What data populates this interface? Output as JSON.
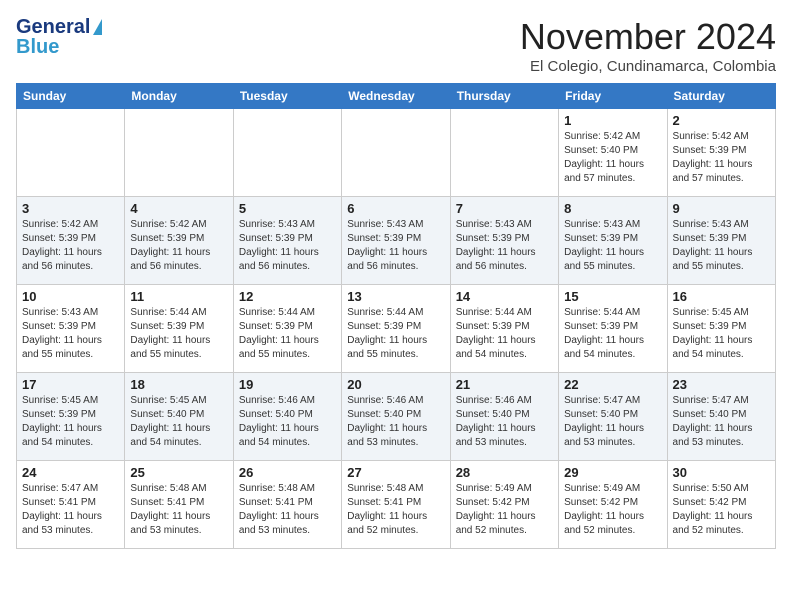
{
  "header": {
    "logo_line1": "General",
    "logo_line2": "Blue",
    "month_title": "November 2024",
    "location": "El Colegio, Cundinamarca, Colombia"
  },
  "weekdays": [
    "Sunday",
    "Monday",
    "Tuesday",
    "Wednesday",
    "Thursday",
    "Friday",
    "Saturday"
  ],
  "weeks": [
    [
      {
        "day": "",
        "info": ""
      },
      {
        "day": "",
        "info": ""
      },
      {
        "day": "",
        "info": ""
      },
      {
        "day": "",
        "info": ""
      },
      {
        "day": "",
        "info": ""
      },
      {
        "day": "1",
        "info": "Sunrise: 5:42 AM\nSunset: 5:40 PM\nDaylight: 11 hours\nand 57 minutes."
      },
      {
        "day": "2",
        "info": "Sunrise: 5:42 AM\nSunset: 5:39 PM\nDaylight: 11 hours\nand 57 minutes."
      }
    ],
    [
      {
        "day": "3",
        "info": "Sunrise: 5:42 AM\nSunset: 5:39 PM\nDaylight: 11 hours\nand 56 minutes."
      },
      {
        "day": "4",
        "info": "Sunrise: 5:42 AM\nSunset: 5:39 PM\nDaylight: 11 hours\nand 56 minutes."
      },
      {
        "day": "5",
        "info": "Sunrise: 5:43 AM\nSunset: 5:39 PM\nDaylight: 11 hours\nand 56 minutes."
      },
      {
        "day": "6",
        "info": "Sunrise: 5:43 AM\nSunset: 5:39 PM\nDaylight: 11 hours\nand 56 minutes."
      },
      {
        "day": "7",
        "info": "Sunrise: 5:43 AM\nSunset: 5:39 PM\nDaylight: 11 hours\nand 56 minutes."
      },
      {
        "day": "8",
        "info": "Sunrise: 5:43 AM\nSunset: 5:39 PM\nDaylight: 11 hours\nand 55 minutes."
      },
      {
        "day": "9",
        "info": "Sunrise: 5:43 AM\nSunset: 5:39 PM\nDaylight: 11 hours\nand 55 minutes."
      }
    ],
    [
      {
        "day": "10",
        "info": "Sunrise: 5:43 AM\nSunset: 5:39 PM\nDaylight: 11 hours\nand 55 minutes."
      },
      {
        "day": "11",
        "info": "Sunrise: 5:44 AM\nSunset: 5:39 PM\nDaylight: 11 hours\nand 55 minutes."
      },
      {
        "day": "12",
        "info": "Sunrise: 5:44 AM\nSunset: 5:39 PM\nDaylight: 11 hours\nand 55 minutes."
      },
      {
        "day": "13",
        "info": "Sunrise: 5:44 AM\nSunset: 5:39 PM\nDaylight: 11 hours\nand 55 minutes."
      },
      {
        "day": "14",
        "info": "Sunrise: 5:44 AM\nSunset: 5:39 PM\nDaylight: 11 hours\nand 54 minutes."
      },
      {
        "day": "15",
        "info": "Sunrise: 5:44 AM\nSunset: 5:39 PM\nDaylight: 11 hours\nand 54 minutes."
      },
      {
        "day": "16",
        "info": "Sunrise: 5:45 AM\nSunset: 5:39 PM\nDaylight: 11 hours\nand 54 minutes."
      }
    ],
    [
      {
        "day": "17",
        "info": "Sunrise: 5:45 AM\nSunset: 5:39 PM\nDaylight: 11 hours\nand 54 minutes."
      },
      {
        "day": "18",
        "info": "Sunrise: 5:45 AM\nSunset: 5:40 PM\nDaylight: 11 hours\nand 54 minutes."
      },
      {
        "day": "19",
        "info": "Sunrise: 5:46 AM\nSunset: 5:40 PM\nDaylight: 11 hours\nand 54 minutes."
      },
      {
        "day": "20",
        "info": "Sunrise: 5:46 AM\nSunset: 5:40 PM\nDaylight: 11 hours\nand 53 minutes."
      },
      {
        "day": "21",
        "info": "Sunrise: 5:46 AM\nSunset: 5:40 PM\nDaylight: 11 hours\nand 53 minutes."
      },
      {
        "day": "22",
        "info": "Sunrise: 5:47 AM\nSunset: 5:40 PM\nDaylight: 11 hours\nand 53 minutes."
      },
      {
        "day": "23",
        "info": "Sunrise: 5:47 AM\nSunset: 5:40 PM\nDaylight: 11 hours\nand 53 minutes."
      }
    ],
    [
      {
        "day": "24",
        "info": "Sunrise: 5:47 AM\nSunset: 5:41 PM\nDaylight: 11 hours\nand 53 minutes."
      },
      {
        "day": "25",
        "info": "Sunrise: 5:48 AM\nSunset: 5:41 PM\nDaylight: 11 hours\nand 53 minutes."
      },
      {
        "day": "26",
        "info": "Sunrise: 5:48 AM\nSunset: 5:41 PM\nDaylight: 11 hours\nand 53 minutes."
      },
      {
        "day": "27",
        "info": "Sunrise: 5:48 AM\nSunset: 5:41 PM\nDaylight: 11 hours\nand 52 minutes."
      },
      {
        "day": "28",
        "info": "Sunrise: 5:49 AM\nSunset: 5:42 PM\nDaylight: 11 hours\nand 52 minutes."
      },
      {
        "day": "29",
        "info": "Sunrise: 5:49 AM\nSunset: 5:42 PM\nDaylight: 11 hours\nand 52 minutes."
      },
      {
        "day": "30",
        "info": "Sunrise: 5:50 AM\nSunset: 5:42 PM\nDaylight: 11 hours\nand 52 minutes."
      }
    ]
  ]
}
